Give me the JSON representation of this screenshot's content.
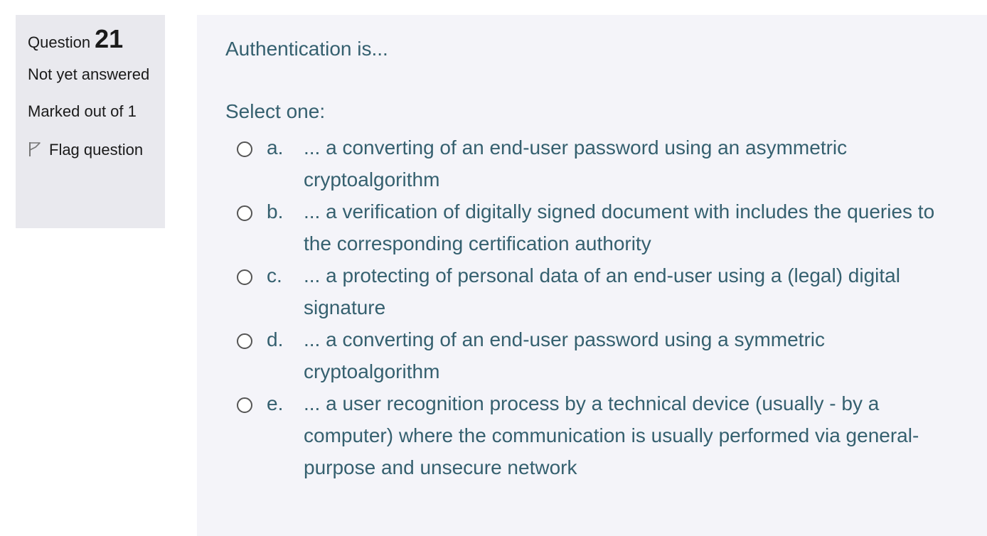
{
  "question_info": {
    "label": "Question",
    "number": "21",
    "state": "Not yet answered",
    "grade": "Marked out of 1",
    "flag_label": "Flag question",
    "flag_icon": "flag-icon"
  },
  "question": {
    "text": "Authentication is...",
    "prompt": "Select one:",
    "answers": [
      {
        "letter": "a.",
        "text": "... a converting of an end-user password using an asymmetric cryptoalgorithm",
        "selected": false
      },
      {
        "letter": "b.",
        "text": "... a verification of digitally signed document with includes the queries to the corresponding certification authority",
        "selected": false
      },
      {
        "letter": "c.",
        "text": "... a protecting of personal data of an end-user using a (legal) digital signature",
        "selected": false
      },
      {
        "letter": "d.",
        "text": "... a converting of an end-user password using a symmetric cryptoalgorithm",
        "selected": false
      },
      {
        "letter": "e.",
        "text": "... a user recognition process by a technical device (usually - by a computer) where the communication is usually performed via general-purpose and unsecure network",
        "selected": false
      }
    ]
  },
  "colors": {
    "info_bg": "#e9e9ee",
    "content_bg": "#f4f4f9",
    "text_accent": "#35606f"
  }
}
